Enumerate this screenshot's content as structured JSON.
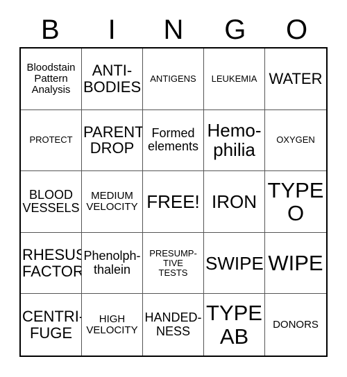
{
  "card": {
    "header_letters": [
      "B",
      "I",
      "N",
      "G",
      "O"
    ],
    "cells": [
      {
        "text": "Bloodstain\nPattern\nAnalysis",
        "size": "s"
      },
      {
        "text": "ANTI-\nBODIES",
        "size": "l"
      },
      {
        "text": "ANTIGENS",
        "size": "xs"
      },
      {
        "text": "LEUKEMIA",
        "size": "xs"
      },
      {
        "text": "WATER",
        "size": "l"
      },
      {
        "text": "PROTECT",
        "size": "xs"
      },
      {
        "text": "PARENT\nDROP",
        "size": "l"
      },
      {
        "text": "Formed\nelements",
        "size": "m"
      },
      {
        "text": "Hemo-\nphilia",
        "size": "xl"
      },
      {
        "text": "OXYGEN",
        "size": "xs"
      },
      {
        "text": "BLOOD\nVESSELS",
        "size": "m"
      },
      {
        "text": "MEDIUM\nVELOCITY",
        "size": "s"
      },
      {
        "text": "FREE!",
        "size": "xl"
      },
      {
        "text": "IRON",
        "size": "xl"
      },
      {
        "text": "TYPE\nO",
        "size": "xxl"
      },
      {
        "text": "RHESUS\nFACTOR",
        "size": "l"
      },
      {
        "text": "Phenolph-\nthalein",
        "size": "m"
      },
      {
        "text": "PRESUMP-\nTIVE\nTESTS",
        "size": "xs"
      },
      {
        "text": "SWIPE",
        "size": "xl"
      },
      {
        "text": "WIPE",
        "size": "xxl"
      },
      {
        "text": "CENTRI-\nFUGE",
        "size": "l"
      },
      {
        "text": "HIGH\nVELOCITY",
        "size": "s"
      },
      {
        "text": "HANDED-\nNESS",
        "size": "m"
      },
      {
        "text": "TYPE\nAB",
        "size": "xxl"
      },
      {
        "text": "DONORS",
        "size": "s"
      }
    ]
  },
  "colors": {
    "outer_border": "#000000",
    "inner_grid_line": "#555555",
    "background": "#ffffff",
    "text": "#000000"
  }
}
